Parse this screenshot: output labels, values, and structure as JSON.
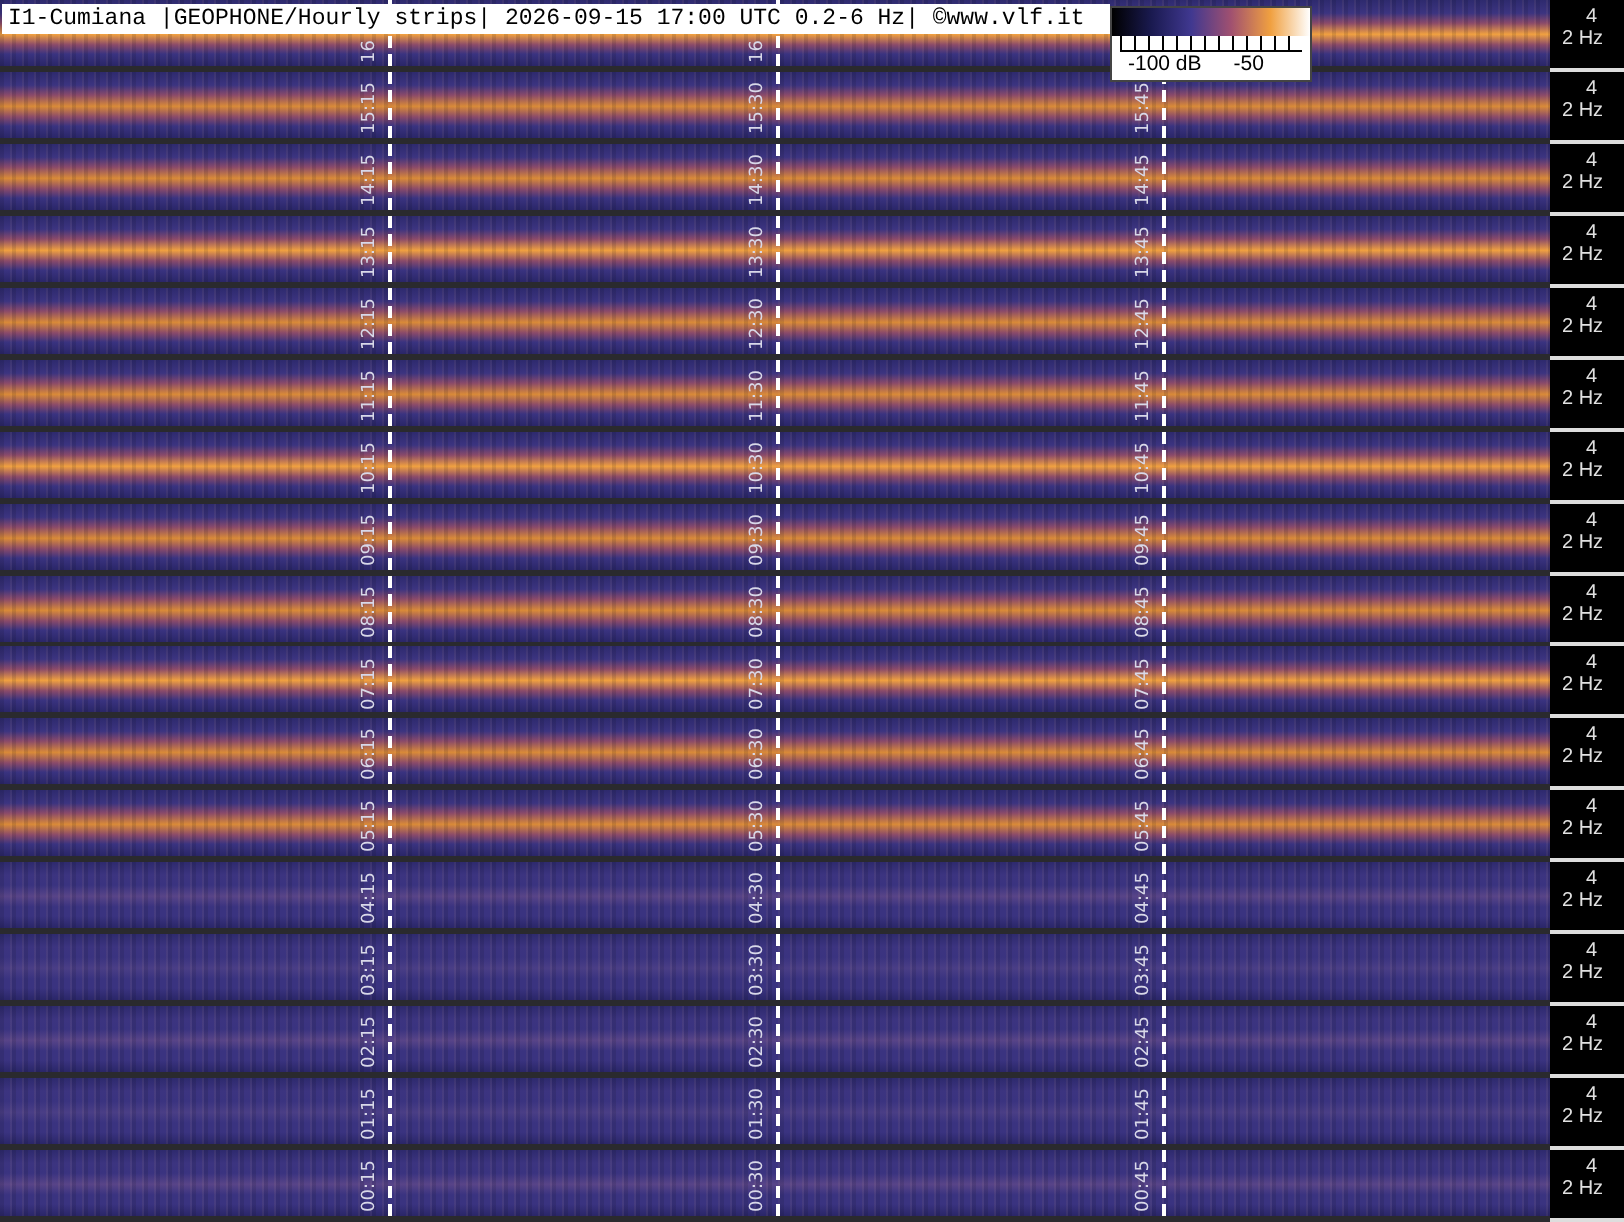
{
  "title": "I1-Cumiana |GEOPHONE/Hourly strips| 2026-09-15 17:00 UTC 0.2-6 Hz| ©www.vlf.it",
  "colorbar": {
    "labels": [
      "-100 dB",
      "-50"
    ]
  },
  "strips": [
    {
      "time_labels": [
        "16",
        "16"
      ],
      "axis": [
        "4",
        "2 Hz"
      ]
    },
    {
      "time_labels": [
        "15:15",
        "15:30",
        "15:45"
      ],
      "axis": [
        "4",
        "2 Hz"
      ]
    },
    {
      "time_labels": [
        "14:15",
        "14:30",
        "14:45"
      ],
      "axis": [
        "4",
        "2 Hz"
      ]
    },
    {
      "time_labels": [
        "13:15",
        "13:30",
        "13:45"
      ],
      "axis": [
        "4",
        "2 Hz"
      ]
    },
    {
      "time_labels": [
        "12:15",
        "12:30",
        "12:45"
      ],
      "axis": [
        "4",
        "2 Hz"
      ]
    },
    {
      "time_labels": [
        "11:15",
        "11:30",
        "11:45"
      ],
      "axis": [
        "4",
        "2 Hz"
      ]
    },
    {
      "time_labels": [
        "10:15",
        "10:30",
        "10:45"
      ],
      "axis": [
        "4",
        "2 Hz"
      ]
    },
    {
      "time_labels": [
        "09:15",
        "09:30",
        "09:45"
      ],
      "axis": [
        "4",
        "2 Hz"
      ]
    },
    {
      "time_labels": [
        "08:15",
        "08:30",
        "08:45"
      ],
      "axis": [
        "4",
        "2 Hz"
      ]
    },
    {
      "time_labels": [
        "07:15",
        "07:30",
        "07:45"
      ],
      "axis": [
        "4",
        "2 Hz"
      ]
    },
    {
      "time_labels": [
        "06:15",
        "06:30",
        "06:45"
      ],
      "axis": [
        "4",
        "2 Hz"
      ]
    },
    {
      "time_labels": [
        "05:15",
        "05:30",
        "05:45"
      ],
      "axis": [
        "4",
        "2 Hz"
      ]
    },
    {
      "time_labels": [
        "04:15",
        "04:30",
        "04:45"
      ],
      "axis": [
        "4",
        "2 Hz"
      ]
    },
    {
      "time_labels": [
        "03:15",
        "03:30",
        "03:45"
      ],
      "axis": [
        "4",
        "2 Hz"
      ]
    },
    {
      "time_labels": [
        "02:15",
        "02:30",
        "02:45"
      ],
      "axis": [
        "4",
        "2 Hz"
      ]
    },
    {
      "time_labels": [
        "01:15",
        "01:30",
        "01:45"
      ],
      "axis": [
        "4",
        "2 Hz"
      ]
    },
    {
      "time_labels": [
        "00:15",
        "00:30",
        "00:45"
      ],
      "axis": [
        "4",
        "2 Hz"
      ]
    }
  ]
}
